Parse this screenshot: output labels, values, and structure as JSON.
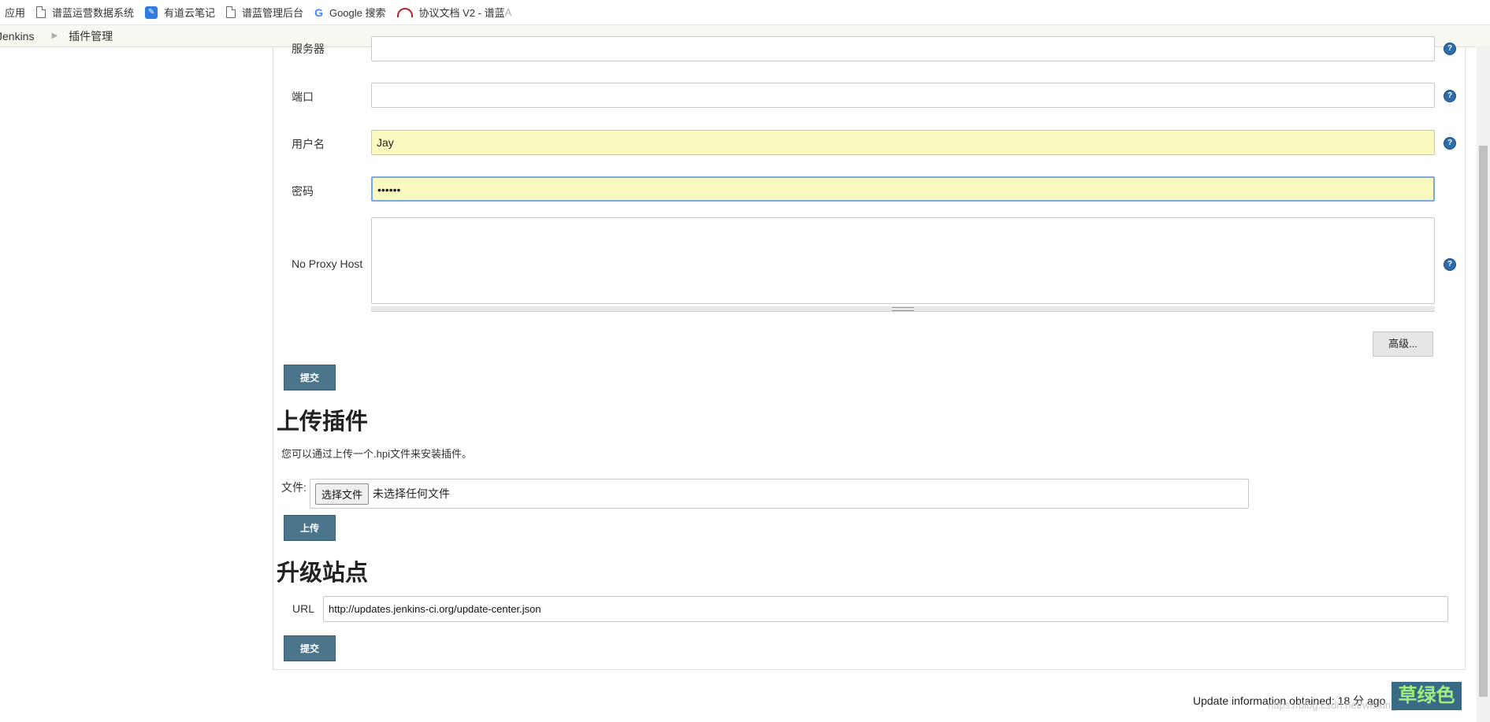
{
  "bookmarks": [
    {
      "label": "应用",
      "icon": "apps-icon"
    },
    {
      "label": "谱蓝运营数据系统",
      "icon": "page-icon"
    },
    {
      "label": "有道云笔记",
      "icon": "youdao-icon"
    },
    {
      "label": "谱蓝管理后台",
      "icon": "page-icon"
    },
    {
      "label": "Google 搜索",
      "icon": "google-icon"
    },
    {
      "label": "协议文档 V2 - 谱蓝",
      "icon": "cloud-icon"
    }
  ],
  "breadcrumb": {
    "root": "Jenkins",
    "current": "插件管理"
  },
  "proxy": {
    "server_label": "服务器",
    "port_label": "端口",
    "port_value": "",
    "username_label": "用户名",
    "username_value": "Jay",
    "password_label": "密码",
    "password_value": "••••••",
    "no_proxy_label": "No Proxy Host",
    "advanced_button": "高级...",
    "submit_button": "提交"
  },
  "upload": {
    "heading": "上传插件",
    "description": "您可以通过上传一个.hpi文件来安装插件。",
    "file_label": "文件:",
    "choose_button": "选择文件",
    "no_file_text": "未选择任何文件",
    "upload_button": "上传"
  },
  "update_site": {
    "heading": "升级站点",
    "url_label": "URL",
    "url_value": "http://updates.jenkins-ci.org/update-center.json",
    "submit_button": "提交"
  },
  "footer": {
    "update_info": "Update information obtained: 18 分 ago",
    "watermark": "https://blog.csdn.net/weixin_38779094",
    "color_badge": "草绿色"
  },
  "colors": {
    "accent_button": "#4b758b",
    "filled_field": "#fafac0",
    "help_icon": "#2e6ca8"
  }
}
